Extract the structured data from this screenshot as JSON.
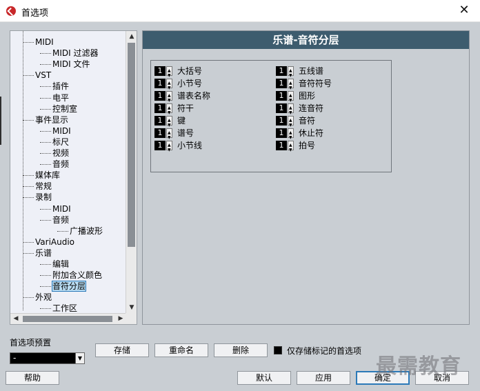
{
  "window": {
    "title": "首选项",
    "close_icon": "close-icon"
  },
  "tree": {
    "items": [
      {
        "label": "MIDI",
        "level": 1
      },
      {
        "label": "MIDI 过滤器",
        "level": 2
      },
      {
        "label": "MIDI 文件",
        "level": 2
      },
      {
        "label": "VST",
        "level": 1
      },
      {
        "label": "插件",
        "level": 2
      },
      {
        "label": "电平",
        "level": 2
      },
      {
        "label": "控制室",
        "level": 2
      },
      {
        "label": "事件显示",
        "level": 1
      },
      {
        "label": "MIDI",
        "level": 2
      },
      {
        "label": "标尺",
        "level": 2
      },
      {
        "label": "视频",
        "level": 2
      },
      {
        "label": "音频",
        "level": 2
      },
      {
        "label": "媒体库",
        "level": 1
      },
      {
        "label": "常规",
        "level": 1
      },
      {
        "label": "录制",
        "level": 1
      },
      {
        "label": "MIDI",
        "level": 2
      },
      {
        "label": "音频",
        "level": 2
      },
      {
        "label": "广播波形",
        "level": 3
      },
      {
        "label": "VariAudio",
        "level": 1
      },
      {
        "label": "乐谱",
        "level": 1
      },
      {
        "label": "编辑",
        "level": 2
      },
      {
        "label": "附加含义颜色",
        "level": 2
      },
      {
        "label": "音符分层",
        "level": 2,
        "selected": true
      },
      {
        "label": "外观",
        "level": 1
      },
      {
        "label": "工作区",
        "level": 2
      }
    ]
  },
  "panel": {
    "header": "乐谱-音符分层",
    "left_column": [
      {
        "value": "1",
        "label": "大括号"
      },
      {
        "value": "1",
        "label": "小节号"
      },
      {
        "value": "1",
        "label": "谱表名称"
      },
      {
        "value": "1",
        "label": "符干"
      },
      {
        "value": "1",
        "label": "键"
      },
      {
        "value": "1",
        "label": "谱号"
      },
      {
        "value": "1",
        "label": "小节线"
      }
    ],
    "right_column": [
      {
        "value": "1",
        "label": "五线谱"
      },
      {
        "value": "1",
        "label": "音符符号"
      },
      {
        "value": "1",
        "label": "图形"
      },
      {
        "value": "1",
        "label": "连音符"
      },
      {
        "value": "1",
        "label": "音符"
      },
      {
        "value": "1",
        "label": "休止符"
      },
      {
        "value": "1",
        "label": "拍号"
      }
    ]
  },
  "presets": {
    "label": "首选项预置",
    "selected": "-",
    "store_label": "存储",
    "rename_label": "重命名",
    "delete_label": "删除",
    "only_marked_label": "仅存储标记的首选项"
  },
  "footer": {
    "help_label": "帮助",
    "default_label": "默认",
    "apply_label": "应用",
    "ok_label": "确定",
    "cancel_label": "取消"
  },
  "watermark": "最需教育"
}
